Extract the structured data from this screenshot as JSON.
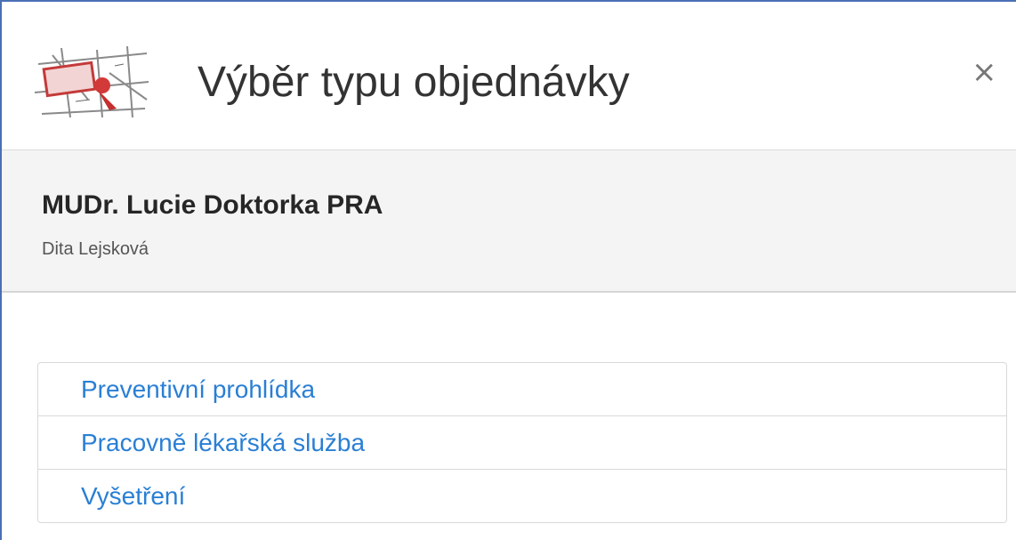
{
  "dialog": {
    "title": "Výběr typu objednávky",
    "close_label": "×",
    "logo_icon": "map-pin-logo-icon"
  },
  "info": {
    "doctor": "MUDr. Lucie Doktorka PRA",
    "patient": "Dita Lejsková"
  },
  "order_types": [
    {
      "label": "Preventivní prohlídka"
    },
    {
      "label": "Pracovně lékařská služba"
    },
    {
      "label": "Vyšetření"
    }
  ],
  "colors": {
    "accent_link": "#2a7fd4",
    "window_border": "#4a6fb5",
    "info_background": "#f4f4f4"
  }
}
